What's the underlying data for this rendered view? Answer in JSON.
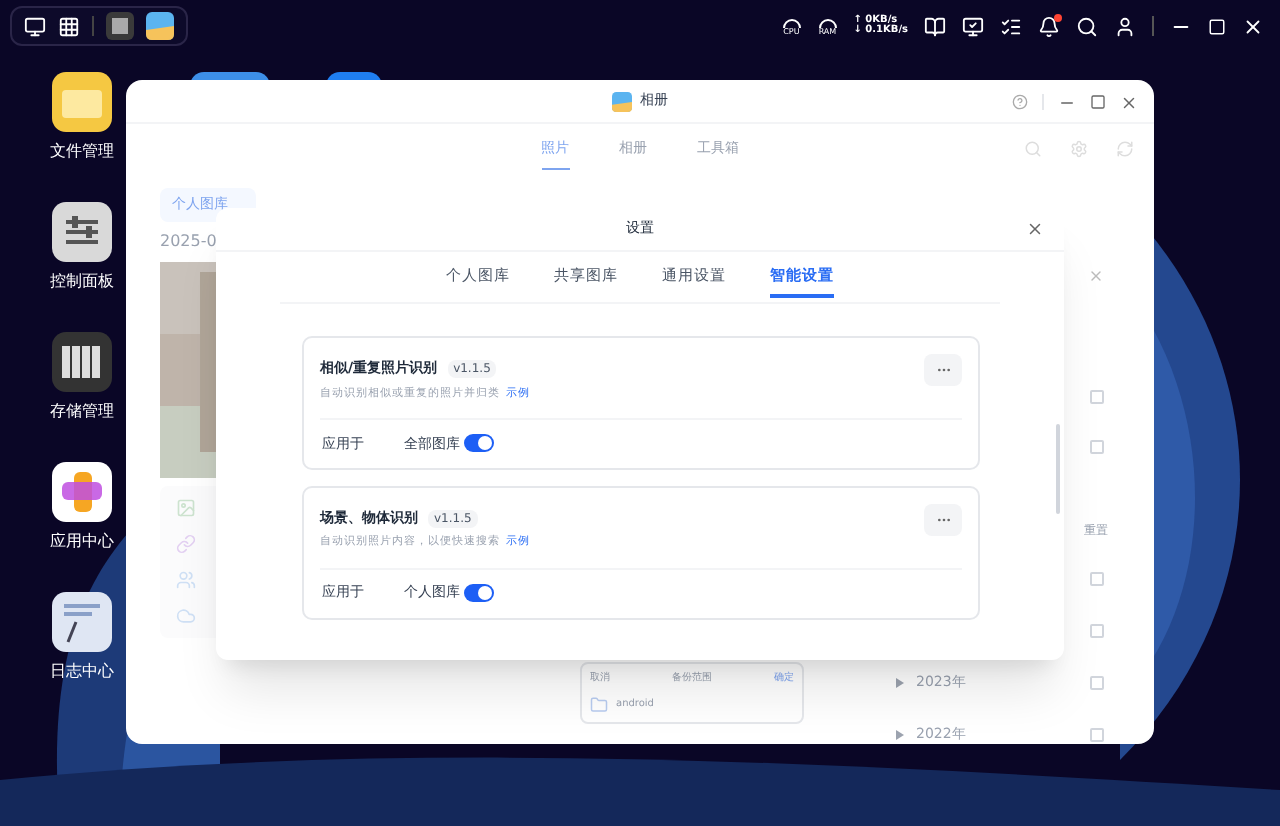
{
  "taskbar": {
    "cpu_label": "CPU",
    "ram_label": "RAM",
    "upload": "↑ 0KB/s",
    "download": "↓ 0.1KB/s",
    "notifications_unread": true
  },
  "desktop_icons": [
    {
      "label": "文件管理",
      "kind": "folder"
    },
    {
      "label": "控制面板",
      "kind": "panel"
    },
    {
      "label": "存储管理",
      "kind": "storage"
    },
    {
      "label": "应用中心",
      "kind": "apps"
    },
    {
      "label": "日志中心",
      "kind": "logs"
    }
  ],
  "app_window": {
    "title": "相册",
    "tabs": [
      {
        "label": "照片",
        "selected": true
      },
      {
        "label": "相册",
        "selected": false
      },
      {
        "label": "工具箱",
        "selected": false
      }
    ],
    "library_chip": "个人图库",
    "date_heading": "2025-0",
    "backup_panel": {
      "cancel": "取消",
      "title": "备份范围",
      "confirm": "确定",
      "folder": "android"
    },
    "right_panel": {
      "top_rows": [
        {
          "checked": false
        },
        {
          "checked": false
        }
      ],
      "reset": "重置",
      "rows": [
        {
          "checked": false
        },
        {
          "checked": false
        },
        {
          "label": "2023年",
          "checked": false
        },
        {
          "label": "2022年",
          "checked": false
        }
      ]
    }
  },
  "dialog": {
    "title": "设置",
    "tabs": [
      {
        "label": "个人图库",
        "selected": false
      },
      {
        "label": "共享图库",
        "selected": false
      },
      {
        "label": "通用设置",
        "selected": false
      },
      {
        "label": "智能设置",
        "selected": true
      }
    ],
    "features": [
      {
        "name": "相似/重复照片识别",
        "version": "v1.1.5",
        "description": "自动识别相似或重复的照片并归类",
        "link": "示例",
        "apply_label": "应用于",
        "scope": "全部图库",
        "on": true
      },
      {
        "name": "场景、物体识别",
        "version": "v1.1.5",
        "description": "自动识别照片内容，以便快速搜索",
        "link": "示例",
        "apply_label": "应用于",
        "scope": "个人图库",
        "on": true
      }
    ]
  }
}
